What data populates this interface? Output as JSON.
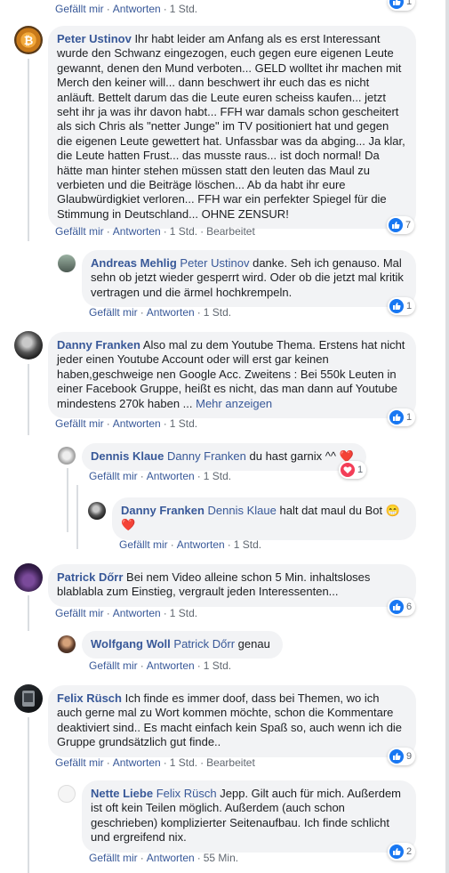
{
  "labels": {
    "like": "Gefällt mir",
    "reply": "Antworten",
    "edited": "Bearbeitet",
    "dot": "·"
  },
  "colors": {
    "link": "#385898",
    "bubble": "#f2f3f5",
    "like": "#1877f2",
    "heart": "#f33e58"
  },
  "top": {
    "time": "1 Std.",
    "reactions": "1"
  },
  "c1": {
    "author": "Peter Ustinov",
    "text": "Ihr habt leider am Anfang als es erst Interessant wurde den Schwanz eingezogen, euch gegen eure eigenen Leute gewannt, denen den Mund verboten... GELD wolltet ihr machen mit Merch den keiner will... dann beschwert ihr euch das es nicht anläuft. Bettelt darum das die Leute euren scheiss kaufen... jetzt seht ihr ja was ihr davon habt... FFH war damals schon gescheitert als sich Chris als \"netter Junge\" im TV positioniert hat und gegen die eigenen Leute gewettert hat. Unfassbar was da abging... Ja klar, die Leute hatten Frust... das musste raus... ist doch normal! Da hätte man hinter stehen müssen statt den leuten das Maul zu verbieten und die Beiträge löschen... Ab da habt ihr eure Glaubwürdigkiet verloren... FFH war ein perfekter Spiegel für die Stimmung in Deutschland... OHNE ZENSUR!",
    "time": "1 Std.",
    "reactions": "7"
  },
  "c1r1": {
    "author": "Andreas Mehlig",
    "mention": "Peter Ustinov",
    "text": "danke. Seh ich genauso. Mal sehn ob jetzt wieder gesperrt wird. Oder ob die jetzt mal kritik vertragen und die ärmel hochkrempeln.",
    "time": "1 Std.",
    "reactions": "1"
  },
  "c2": {
    "author": "Danny Franken",
    "text": "Also mal zu dem Youtube Thema. Erstens hat nicht jeder einen Youtube Account oder will erst gar keinen haben,geschweige nen Google Acc. Zweitens : Bei 550k Leuten in einer Facebook Gruppe, heißt es nicht, das man dann auf Youtube mindestens 270k haben ...",
    "more": "Mehr anzeigen",
    "time": "1 Std.",
    "reactions": "1"
  },
  "c2r1": {
    "author": "Dennis Klaue",
    "mention": "Danny Franken",
    "text": "du hast garnix ^^ ❤️",
    "time": "1 Std.",
    "reactions": "1"
  },
  "c2r2": {
    "author": "Danny Franken",
    "mention": "Dennis Klaue",
    "text": "halt dat maul du Bot 😁 ❤️",
    "time": "1 Std."
  },
  "c3": {
    "author": "Patrick Dőrr",
    "text": "Bei nem Video alleine schon 5 Min. inhaltsloses blablabla zum Einstieg, vergrault jeden Interessenten...",
    "time": "1 Std.",
    "reactions": "6"
  },
  "c3r1": {
    "author": "Wolfgang Woll",
    "mention": "Patrick Dőrr",
    "text": "genau",
    "time": "1 Std."
  },
  "c4": {
    "author": "Felix Rüsch",
    "text": "Ich finde es immer doof, dass bei Themen, wo ich auch gerne mal zu Wort kommen möchte, schon die Kommentare deaktiviert sind.. Es macht einfach kein Spaß so, auch wenn ich die Gruppe grundsätzlich gut finde..",
    "time": "1 Std.",
    "reactions": "9"
  },
  "c4r1": {
    "author": "Nette Liebe",
    "mention": "Felix Rüsch",
    "text": "Jepp. Gilt auch für mich. Außerdem ist oft kein Teilen möglich. Außerdem (auch schon geschrieben) komplizierter Seitenaufbau. Ich finde schlicht und ergreifend nix.",
    "time": "55 Min.",
    "reactions": "2"
  }
}
